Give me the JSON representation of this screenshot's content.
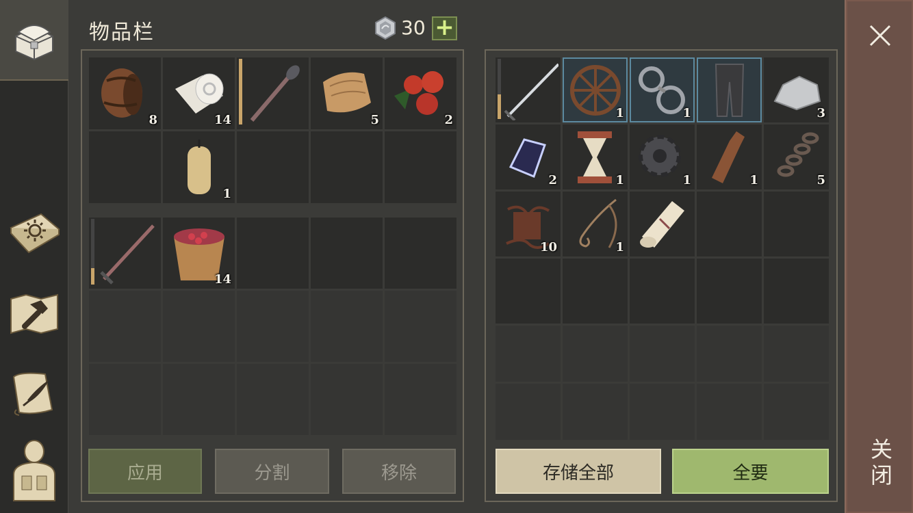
{
  "header": {
    "title": "物品栏",
    "currency_count": "30",
    "add_label": "+"
  },
  "sidebar": {
    "items": [
      {
        "name": "chest-icon",
        "active": true
      },
      {
        "name": "sun-book-icon"
      },
      {
        "name": "hammer-map-icon"
      },
      {
        "name": "scroll-quill-icon"
      },
      {
        "name": "character-icon"
      }
    ]
  },
  "left_grid_top": [
    {
      "item": "barrel",
      "count": "8"
    },
    {
      "item": "cloth-roll",
      "count": "14"
    },
    {
      "item": "mace",
      "count": "",
      "durability": 1.0
    },
    {
      "item": "fabric",
      "count": "5"
    },
    {
      "item": "berries",
      "count": "2"
    },
    {
      "item": "",
      "count": ""
    },
    {
      "item": "candle",
      "count": "1"
    },
    {
      "item": "",
      "count": ""
    },
    {
      "item": "",
      "count": ""
    },
    {
      "item": "",
      "count": ""
    }
  ],
  "left_grid_bottom": [
    {
      "item": "sword",
      "count": "",
      "durability": 0.25
    },
    {
      "item": "berry-bucket",
      "count": "14"
    }
  ],
  "right_grid": [
    {
      "item": "longsword",
      "count": "",
      "durability": 0.4
    },
    {
      "item": "wheel",
      "count": "1",
      "highlight": true
    },
    {
      "item": "shackles",
      "count": "1",
      "highlight": true
    },
    {
      "item": "chain-leggings",
      "count": "",
      "highlight": true
    },
    {
      "item": "stone",
      "count": "3"
    },
    {
      "item": "crystal",
      "count": "2"
    },
    {
      "item": "hourglass",
      "count": "1"
    },
    {
      "item": "gear",
      "count": "1"
    },
    {
      "item": "bottle",
      "count": "1"
    },
    {
      "item": "chain",
      "count": "5"
    },
    {
      "item": "roots",
      "count": "10"
    },
    {
      "item": "rope",
      "count": "1"
    },
    {
      "item": "scroll",
      "count": ""
    }
  ],
  "buttons": {
    "apply": "应用",
    "split": "分割",
    "remove": "移除",
    "store_all": "存储全部",
    "take_all": "全要"
  },
  "close": {
    "label": "关闭"
  },
  "colors": {
    "background": "#3b3b38",
    "cell": "#2c2c2a",
    "take_button": "#9fb86e",
    "store_button": "#cfc4a6",
    "close_panel": "#6b5148",
    "highlight": "#5c8aa0"
  }
}
